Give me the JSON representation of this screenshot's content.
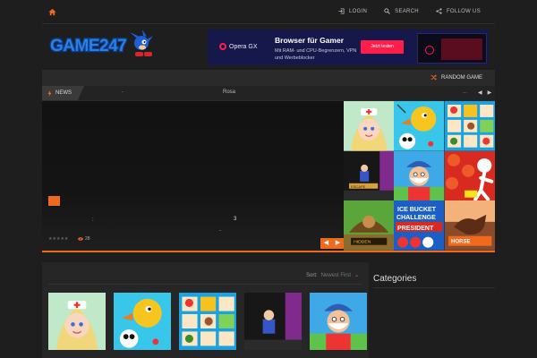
{
  "topbar": {
    "links": [
      {
        "label": "LOGIN",
        "icon": "login-icon"
      },
      {
        "label": "SEARCH",
        "icon": "search-icon"
      },
      {
        "label": "FOLLOW US",
        "icon": "share-icon"
      }
    ]
  },
  "logo": {
    "text": "GAME247"
  },
  "ad": {
    "brand": "Opera GX",
    "headline": "Browser für Gamer",
    "sub": "Mit RAM- und CPU-Begrenzern, VPN und Werbeblocker",
    "cta": "Jetzt testen"
  },
  "featured": {
    "random_label": "RANDOM GAME",
    "news_label": "NEWS",
    "news_dash": "-",
    "news_title": "Rosa",
    "news_dots": "...",
    "slider": {
      "colon": ":",
      "number": "3",
      "dot": "-",
      "stars": "★★★★★",
      "views": "28"
    }
  },
  "games": {
    "sort_label": "Sort:",
    "sort_value": "Newest First"
  },
  "sidebar": {
    "categories_title": "Categories"
  },
  "colors": {
    "accent": "#f06a1e",
    "background": "#1e1e1e",
    "panel": "#2a2a2a"
  }
}
